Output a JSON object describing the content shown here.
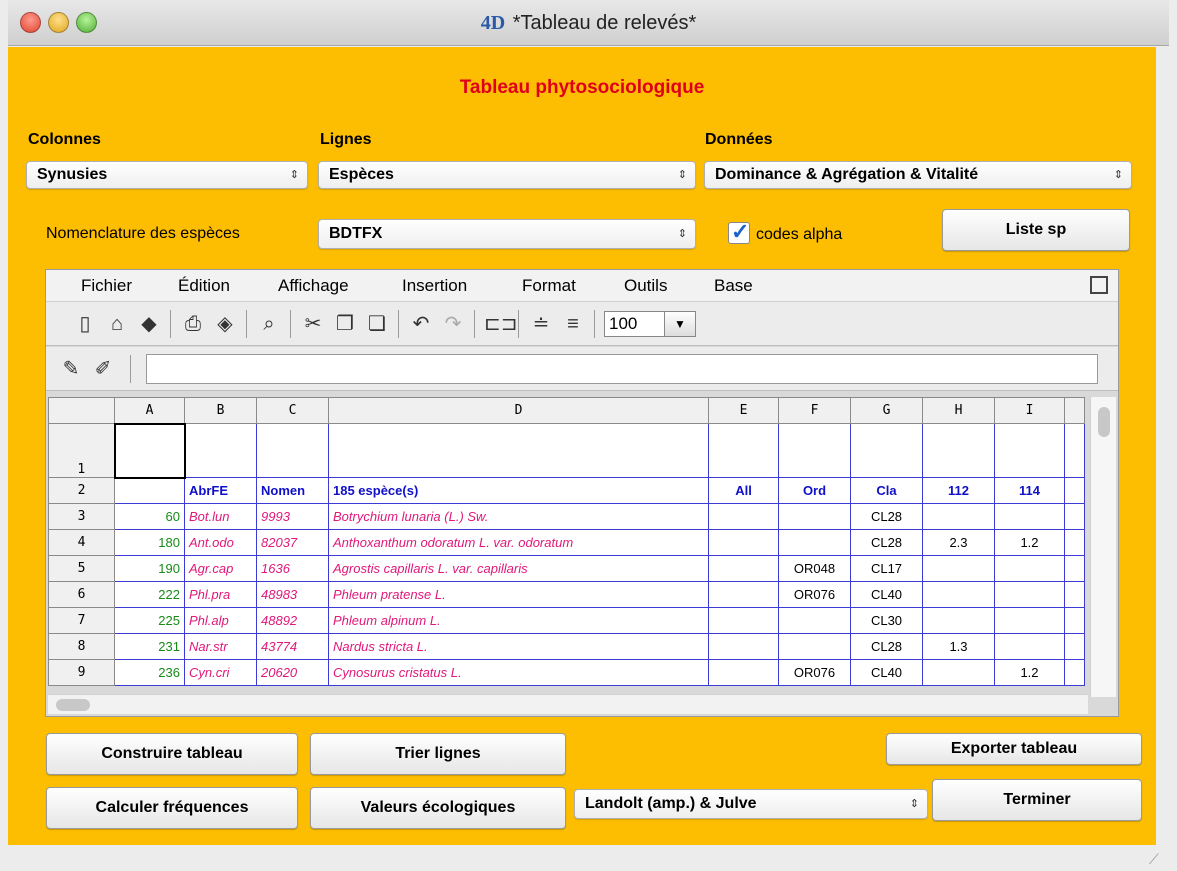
{
  "window": {
    "title": "*Tableau de relevés*",
    "logo": "4D"
  },
  "heading": "Tableau phytosociologique",
  "filters": {
    "colonnes_label": "Colonnes",
    "colonnes_value": "Synusies",
    "lignes_label": "Lignes",
    "lignes_value": "Espèces",
    "donnees_label": "Données",
    "donnees_value": "Dominance & Agrégation & Vitalité",
    "nomenclature_label": "Nomenclature des espèces",
    "nomenclature_value": "BDTFX",
    "codes_alpha_label": "codes alpha",
    "codes_alpha_checked": true,
    "liste_sp_label": "Liste sp"
  },
  "spreadsheet": {
    "menu": [
      "Fichier",
      "Édition",
      "Affichage",
      "Insertion",
      "Format",
      "Outils",
      "Base"
    ],
    "zoom": "100",
    "columns": [
      "A",
      "B",
      "C",
      "D",
      "E",
      "F",
      "G",
      "H",
      "I",
      ""
    ],
    "header_row": {
      "num": "2",
      "a": "",
      "b": "AbrFE",
      "c": "Nomen",
      "d": "185 espèce(s)",
      "e": "All",
      "f": "Ord",
      "g": "Cla",
      "h": "112",
      "i": "114"
    },
    "rows": [
      {
        "num": "3",
        "a": "60",
        "b": "Bot.lun",
        "c": "9993",
        "d": "Botrychium lunaria (L.) Sw.",
        "e": "",
        "f": "",
        "g": "CL28",
        "h": "",
        "i": ""
      },
      {
        "num": "4",
        "a": "180",
        "b": "Ant.odo",
        "c": "82037",
        "d": "Anthoxanthum odoratum L. var. odoratum",
        "e": "",
        "f": "",
        "g": "CL28",
        "h": "2.3",
        "i": "1.2"
      },
      {
        "num": "5",
        "a": "190",
        "b": "Agr.cap",
        "c": "1636",
        "d": "Agrostis capillaris L. var. capillaris",
        "e": "",
        "f": "OR048",
        "g": "CL17",
        "h": "",
        "i": ""
      },
      {
        "num": "6",
        "a": "222",
        "b": "Phl.pra",
        "c": "48983",
        "d": "Phleum pratense L.",
        "e": "",
        "f": "OR076",
        "g": "CL40",
        "h": "",
        "i": ""
      },
      {
        "num": "7",
        "a": "225",
        "b": "Phl.alp",
        "c": "48892",
        "d": "Phleum alpinum L.",
        "e": "",
        "f": "",
        "g": "CL30",
        "h": "",
        "i": ""
      },
      {
        "num": "8",
        "a": "231",
        "b": "Nar.str",
        "c": "43774",
        "d": "Nardus stricta L.",
        "e": "",
        "f": "",
        "g": "CL28",
        "h": "1.3",
        "i": ""
      },
      {
        "num": "9",
        "a": "236",
        "b": "Cyn.cri",
        "c": "20620",
        "d": "Cynosurus cristatus L.",
        "e": "",
        "f": "OR076",
        "g": "CL40",
        "h": "",
        "i": "1.2"
      }
    ],
    "row1_num": "1"
  },
  "buttons": {
    "construire": "Construire tableau",
    "trier": "Trier lignes",
    "exporter": "Exporter tableau",
    "calculer": "Calculer fréquences",
    "valeurs": "Valeurs écologiques",
    "valeurs_select": "Landolt (amp.) & Julve",
    "terminer": "Terminer"
  },
  "colors": {
    "panel": "#fdbd00",
    "heading": "#e0001c",
    "grid_border": "#3b3bd6",
    "code_text": "#e0187a",
    "number_text": "#178a17",
    "header_text": "#1010c8"
  }
}
